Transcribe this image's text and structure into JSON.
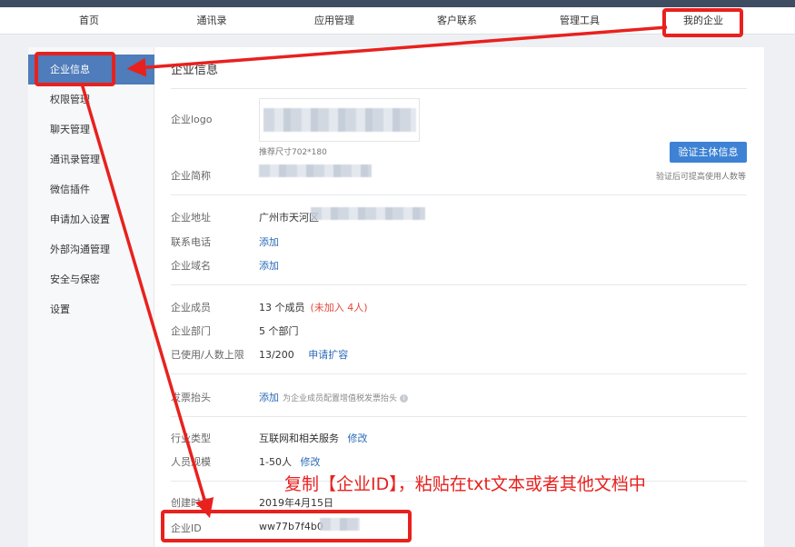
{
  "nav": {
    "items": [
      "首页",
      "通讯录",
      "应用管理",
      "客户联系",
      "管理工具",
      "我的企业"
    ]
  },
  "sidebar": {
    "items": [
      "企业信息",
      "权限管理",
      "聊天管理",
      "通讯录管理",
      "微信插件",
      "申请加入设置",
      "外部沟通管理",
      "安全与保密",
      "设置"
    ]
  },
  "main": {
    "title": "企业信息",
    "logo_label": "企业logo",
    "logo_hint": "推荐尺寸702*180",
    "verify_button": "验证主体信息",
    "verify_hint": "验证后可提高使用人数等",
    "short_name_label": "企业简称",
    "address_label": "企业地址",
    "address_value": "广州市天河区",
    "phone_label": "联系电话",
    "phone_value": "添加",
    "domain_label": "企业域名",
    "domain_value": "添加",
    "members_label": "企业成员",
    "members_value": "13 个成员",
    "members_pending": "(未加入 4人)",
    "departments_label": "企业部门",
    "departments_value": "5 个部门",
    "limit_label": "已使用/人数上限",
    "limit_value": "13/200",
    "limit_link": "申请扩容",
    "invoice_label": "发票抬头",
    "invoice_value": "添加",
    "invoice_hint": "为企业成员配置增值税发票抬头",
    "industry_label": "行业类型",
    "industry_value": "互联网和相关服务",
    "industry_link": "修改",
    "scale_label": "人员规模",
    "scale_value": "1-50人",
    "scale_link": "修改",
    "created_label": "创建时间",
    "created_value": "2019年4月15日",
    "corpid_label": "企业ID",
    "corpid_value": "ww77b7f4b0"
  },
  "annotation": {
    "text": "复制【企业ID】，粘贴在txt文本或者其他文档中",
    "color": "#e8211e"
  },
  "colors": {
    "accent": "#4f7cba",
    "button": "#3d82d4",
    "link": "#2a6ab8"
  }
}
